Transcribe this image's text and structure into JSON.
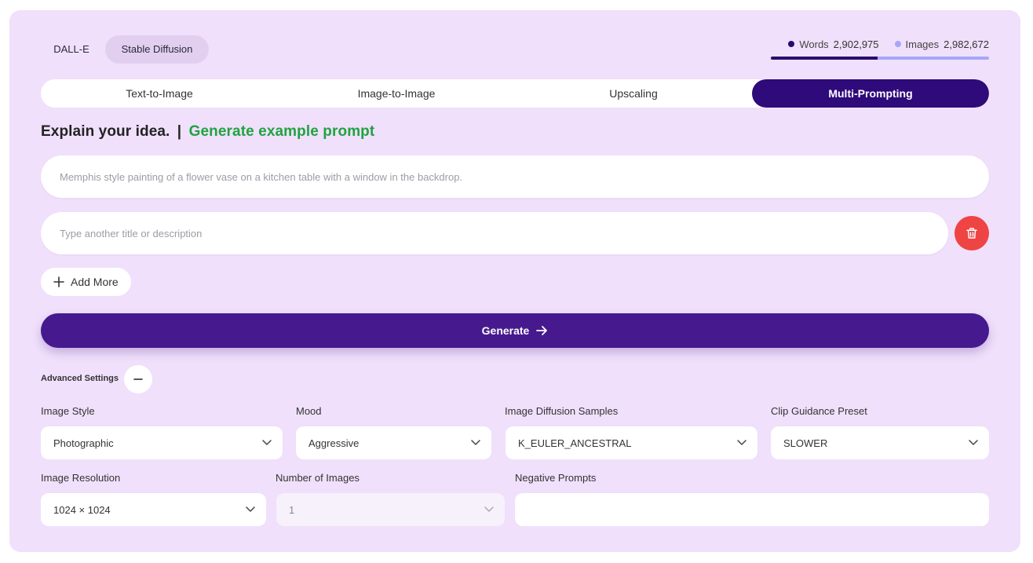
{
  "engines": [
    {
      "label": "DALL-E",
      "active": false
    },
    {
      "label": "Stable Diffusion",
      "active": true
    }
  ],
  "usage": {
    "words_label": "Words",
    "words_value": "2,902,975",
    "images_label": "Images",
    "images_value": "2,982,672",
    "words_fraction": 0.49,
    "colors": {
      "words": "#2a0a6e",
      "images": "#a5a7f7"
    }
  },
  "mode_tabs": [
    {
      "label": "Text-to-Image",
      "active": false
    },
    {
      "label": "Image-to-Image",
      "active": false
    },
    {
      "label": "Upscaling",
      "active": false
    },
    {
      "label": "Multi-Prompting",
      "active": true
    }
  ],
  "heading": {
    "title": "Explain your idea.",
    "separator": "|",
    "link": "Generate example prompt"
  },
  "prompts": {
    "first_placeholder": "Memphis style painting of a flower vase on a kitchen table with a window in the backdrop.",
    "second_placeholder": "Type another title or description",
    "delete_icon": "trash-icon"
  },
  "add_more_label": "Add More",
  "generate_label": "Generate",
  "advanced": {
    "label": "Advanced Settings",
    "toggle_icon": "minus-icon"
  },
  "settings": {
    "image_style": {
      "label": "Image Style",
      "value": "Photographic"
    },
    "mood": {
      "label": "Mood",
      "value": "Aggressive"
    },
    "samples": {
      "label": "Image Diffusion Samples",
      "value": "K_EULER_ANCESTRAL"
    },
    "clip": {
      "label": "Clip Guidance Preset",
      "value": "SLOWER"
    },
    "resolution": {
      "label": "Image Resolution",
      "value": "1024 × 1024"
    },
    "num_images": {
      "label": "Number of Images",
      "value": "1"
    },
    "negative": {
      "label": "Negative Prompts",
      "value": ""
    }
  },
  "colors": {
    "panel_bg": "#f0e0fb",
    "primary": "#2e0a7a",
    "generate": "#461a8e",
    "link_green": "#1fa33f",
    "danger": "#ef4444"
  }
}
